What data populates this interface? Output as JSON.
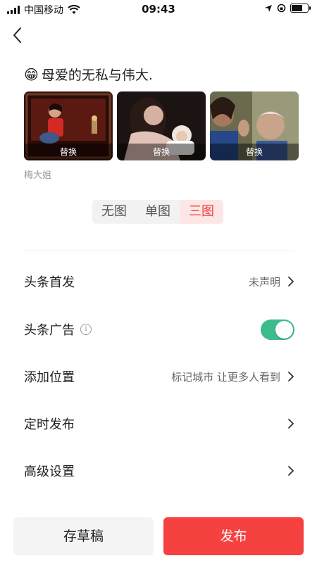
{
  "status_bar": {
    "carrier": "中国移动",
    "time": "09:43",
    "battery_level": 0.7
  },
  "article": {
    "title_emoji": "😁",
    "title": "母爱的无私与伟大.",
    "author": "梅大姐",
    "images": [
      {
        "replace_label": "替换"
      },
      {
        "replace_label": "替换"
      },
      {
        "replace_label": "替换"
      }
    ]
  },
  "cover_mode": {
    "options": [
      "无图",
      "单图",
      "三图"
    ],
    "selected": "三图"
  },
  "settings": [
    {
      "label": "头条首发",
      "value": "未声明"
    },
    {
      "label": "头条广告",
      "toggle": true
    },
    {
      "label": "添加位置",
      "value": "标记城市 让更多人看到"
    },
    {
      "label": "定时发布",
      "value": ""
    },
    {
      "label": "高级设置",
      "value": ""
    }
  ],
  "actions": {
    "draft_label": "存草稿",
    "publish_label": "发布"
  },
  "colors": {
    "accent_red": "#f5413f",
    "toggle_green": "#3dbb8c"
  }
}
